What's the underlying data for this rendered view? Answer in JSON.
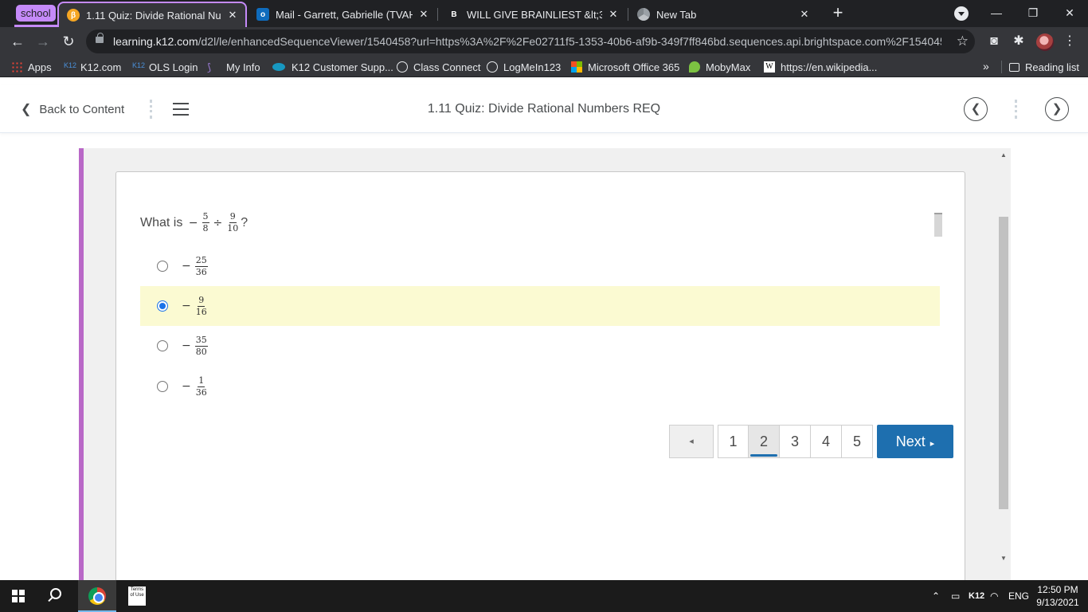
{
  "browser": {
    "tab_group": "school",
    "tabs": [
      {
        "title": "1.11 Quiz: Divide Rational Numb",
        "favicon": "k12-icon",
        "active": true
      },
      {
        "title": "Mail - Garrett, Gabrielle (TVAH St",
        "favicon": "outlook-icon",
        "active": false
      },
      {
        "title": "WILL GIVE BRAINLIEST &lt;3 Wha",
        "favicon": "brainly-icon",
        "active": false
      },
      {
        "title": "New Tab",
        "favicon": "chrome-icon",
        "active": false
      }
    ],
    "url_domain": "learning.k12.com",
    "url_path": "/d2l/le/enhancedSequenceViewer/1540458?url=https%3A%2F%2Fe02711f5-1353-40b6-af9b-349f7ff846bd.sequences.api.brightspace.com%2F154045...",
    "bookmarks": [
      {
        "label": "Apps",
        "icon": "apps-grid-icon"
      },
      {
        "label": "K12.com",
        "icon": "k12-icon"
      },
      {
        "label": "OLS Login",
        "icon": "k12-icon"
      },
      {
        "label": "My Info",
        "icon": "myinfo-icon"
      },
      {
        "label": "K12 Customer Supp...",
        "icon": "salesforce-cloud-icon"
      },
      {
        "label": "Class Connect",
        "icon": "globe-icon"
      },
      {
        "label": "LogMeIn123",
        "icon": "globe-icon"
      },
      {
        "label": "Microsoft Office 365",
        "icon": "microsoft-icon"
      },
      {
        "label": "MobyMax",
        "icon": "mobymax-icon"
      },
      {
        "label": "https://en.wikipedia...",
        "icon": "wikipedia-icon"
      }
    ],
    "bookmarks_overflow": "»",
    "reading_list": "Reading list"
  },
  "header": {
    "back_label": "Back to Content",
    "title": "1.11 Quiz: Divide Rational Numbers REQ"
  },
  "question": {
    "prefix": "What is ",
    "minus": "−",
    "frac1_num": "5",
    "frac1_den": "8",
    "operator": "÷",
    "frac2_num": "9",
    "frac2_den": "10",
    "suffix": "?"
  },
  "options": [
    {
      "sign": "−",
      "num": "25",
      "den": "36",
      "selected": false
    },
    {
      "sign": "−",
      "num": "9",
      "den": "16",
      "selected": true
    },
    {
      "sign": "−",
      "num": "35",
      "den": "80",
      "selected": false
    },
    {
      "sign": "−",
      "num": "1",
      "den": "36",
      "selected": false
    }
  ],
  "pager": {
    "prev": "◂",
    "pages": [
      "1",
      "2",
      "3",
      "4",
      "5"
    ],
    "current_page": "2",
    "next_label": "Next",
    "next_arrow": "▸"
  },
  "taskbar": {
    "terms_label": "Terms of Use",
    "tray_k12": "K12",
    "language": "ENG",
    "time": "12:50 PM",
    "date": "9/13/2021"
  },
  "colors": {
    "accent_bar": "#b968c7",
    "tab_group": "#c58af9",
    "next_button": "#1e6faf",
    "selected_row": "#fbfad2"
  }
}
